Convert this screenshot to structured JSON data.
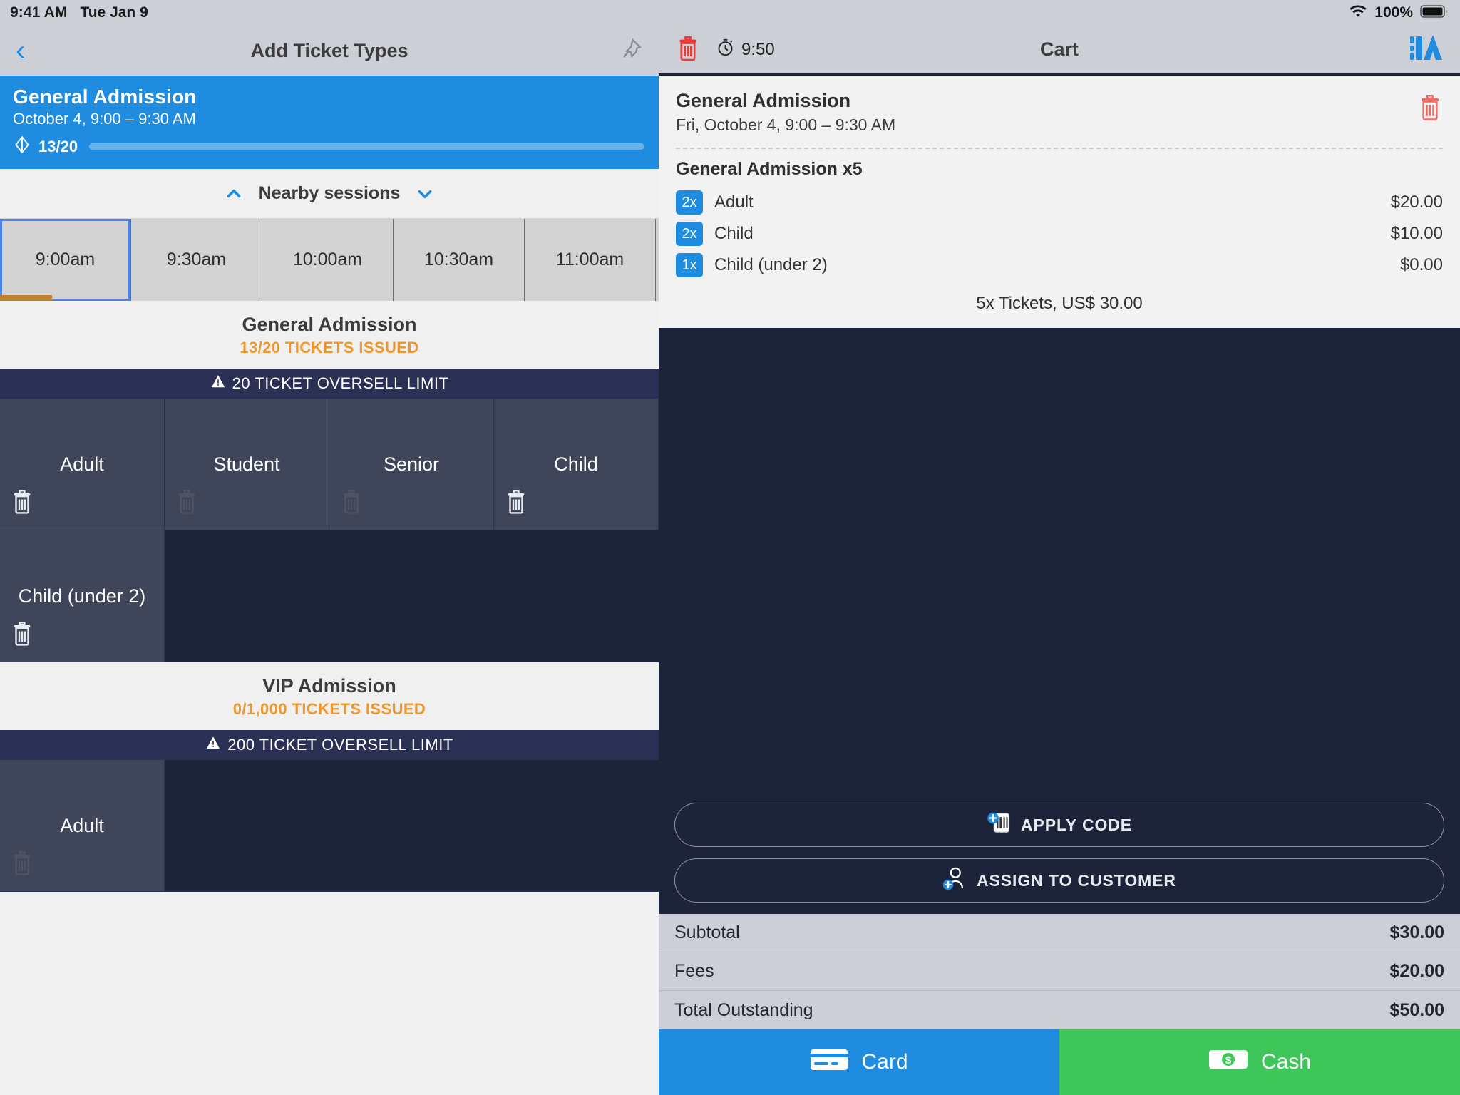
{
  "left": {
    "status": {
      "time": "9:41 AM",
      "date": "Tue Jan 9"
    },
    "nav": {
      "title": "Add Ticket Types",
      "back_icon": "chevron-left-icon",
      "pin_icon": "pin-icon"
    },
    "session_banner": {
      "title": "General Admission",
      "subtitle": "October 4, 9:00 – 9:30 AM",
      "count": "13/20",
      "progress_percent": 65,
      "ticket_icon": "ticket-icon"
    },
    "nearby": {
      "label": "Nearby sessions",
      "up_icon": "chevron-up-icon",
      "down_icon": "chevron-down-icon"
    },
    "slots": [
      {
        "label": "9:00am",
        "selected": true,
        "bar_percent": 40
      },
      {
        "label": "9:30am",
        "selected": false,
        "bar_percent": 0
      },
      {
        "label": "10:00am",
        "selected": false,
        "bar_percent": 0
      },
      {
        "label": "10:30am",
        "selected": false,
        "bar_percent": 0
      },
      {
        "label": "11:00am",
        "selected": false,
        "bar_percent": 0
      }
    ],
    "sections": [
      {
        "title": "General Admission",
        "issued": "13/20 TICKETS ISSUED",
        "oversell": "20 TICKET OVERSELL LIMIT",
        "warning_icon": "warning-icon",
        "types": [
          {
            "label": "Adult",
            "trash_active": true
          },
          {
            "label": "Student",
            "trash_active": false
          },
          {
            "label": "Senior",
            "trash_active": false
          },
          {
            "label": "Child",
            "trash_active": true
          },
          {
            "label": "Child (under 2)",
            "trash_active": true
          }
        ]
      },
      {
        "title": "VIP Admission",
        "issued": "0/1,000 TICKETS ISSUED",
        "oversell": "200 TICKET OVERSELL LIMIT",
        "warning_icon": "warning-icon",
        "types": [
          {
            "label": "Adult",
            "trash_active": false
          }
        ]
      }
    ]
  },
  "right": {
    "status": {
      "battery_percent": "100%",
      "wifi_icon": "wifi-icon",
      "battery_icon": "battery-icon"
    },
    "nav": {
      "title": "Cart",
      "timer": "9:50",
      "timer_icon": "stopwatch-icon",
      "trash_icon": "trash-icon",
      "scan_icon": "scan-ticket-icon"
    },
    "cart_item": {
      "title": "General Admission",
      "date": "Fri, October 4, 9:00 – 9:30 AM",
      "delete_icon": "trash-icon",
      "group_label": "General Admission x5",
      "lines": [
        {
          "qty": "2x",
          "name": "Adult",
          "price": "$20.00"
        },
        {
          "qty": "2x",
          "name": "Child",
          "price": "$10.00"
        },
        {
          "qty": "1x",
          "name": "Child (under 2)",
          "price": "$0.00"
        }
      ],
      "summary": "5x Tickets, US$ 30.00"
    },
    "actions": [
      {
        "label": "APPLY CODE",
        "icon": "apply-code-icon"
      },
      {
        "label": "ASSIGN TO CUSTOMER",
        "icon": "add-customer-icon"
      }
    ],
    "totals": [
      {
        "label": "Subtotal",
        "value": "$30.00"
      },
      {
        "label": "Fees",
        "value": "$20.00"
      },
      {
        "label": "Total Outstanding",
        "value": "$50.00"
      }
    ],
    "pay": [
      {
        "label": "Card",
        "icon": "credit-card-icon",
        "color": "#1f8ce0"
      },
      {
        "label": "Cash",
        "icon": "cash-icon",
        "color": "#3ec65a"
      }
    ]
  }
}
